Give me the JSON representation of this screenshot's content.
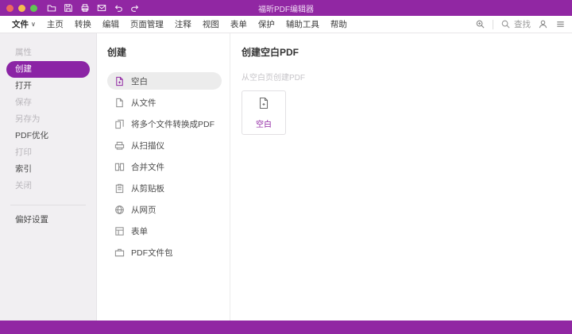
{
  "colors": {
    "accent": "#9127a3",
    "selected_pill": "#8b24a5"
  },
  "icons": {
    "chevron_down": "∨"
  },
  "titlebar": {
    "title": "福昕PDF编辑器",
    "toolbar_icons": [
      "open-folder-icon",
      "save-icon",
      "print-icon",
      "mail-icon",
      "undo-icon",
      "redo-icon"
    ]
  },
  "menubar": {
    "file_label": "文件",
    "items": [
      "主页",
      "转换",
      "编辑",
      "页面管理",
      "注释",
      "视图",
      "表单",
      "保护",
      "辅助工具",
      "帮助"
    ],
    "search_label": "查找"
  },
  "sidebar": {
    "items": [
      {
        "label": "属性",
        "enabled": false,
        "selected": false
      },
      {
        "label": "创建",
        "enabled": true,
        "selected": true
      },
      {
        "label": "打开",
        "enabled": true,
        "selected": false
      },
      {
        "label": "保存",
        "enabled": false,
        "selected": false
      },
      {
        "label": "另存为",
        "enabled": false,
        "selected": false
      },
      {
        "label": "PDF优化",
        "enabled": true,
        "selected": false
      },
      {
        "label": "打印",
        "enabled": false,
        "selected": false
      },
      {
        "label": "索引",
        "enabled": true,
        "selected": false
      },
      {
        "label": "关闭",
        "enabled": false,
        "selected": false
      }
    ],
    "footer_item": "偏好设置"
  },
  "create_panel": {
    "title": "创建",
    "items": [
      {
        "label": "空白",
        "icon": "blank-page-icon",
        "selected": true
      },
      {
        "label": "从文件",
        "icon": "from-file-icon",
        "selected": false
      },
      {
        "label": "将多个文件转换成PDF",
        "icon": "multiple-files-icon",
        "selected": false
      },
      {
        "label": "从扫描仪",
        "icon": "scanner-icon",
        "selected": false
      },
      {
        "label": "合并文件",
        "icon": "combine-files-icon",
        "selected": false
      },
      {
        "label": "从剪贴板",
        "icon": "clipboard-icon",
        "selected": false
      },
      {
        "label": "从网页",
        "icon": "web-page-icon",
        "selected": false
      },
      {
        "label": "表单",
        "icon": "form-icon",
        "selected": false
      },
      {
        "label": "PDF文件包",
        "icon": "pdf-portfolio-icon",
        "selected": false
      }
    ]
  },
  "detail_panel": {
    "title": "创建空白PDF",
    "subtitle": "从空白页创建PDF",
    "card_label": "空白"
  }
}
